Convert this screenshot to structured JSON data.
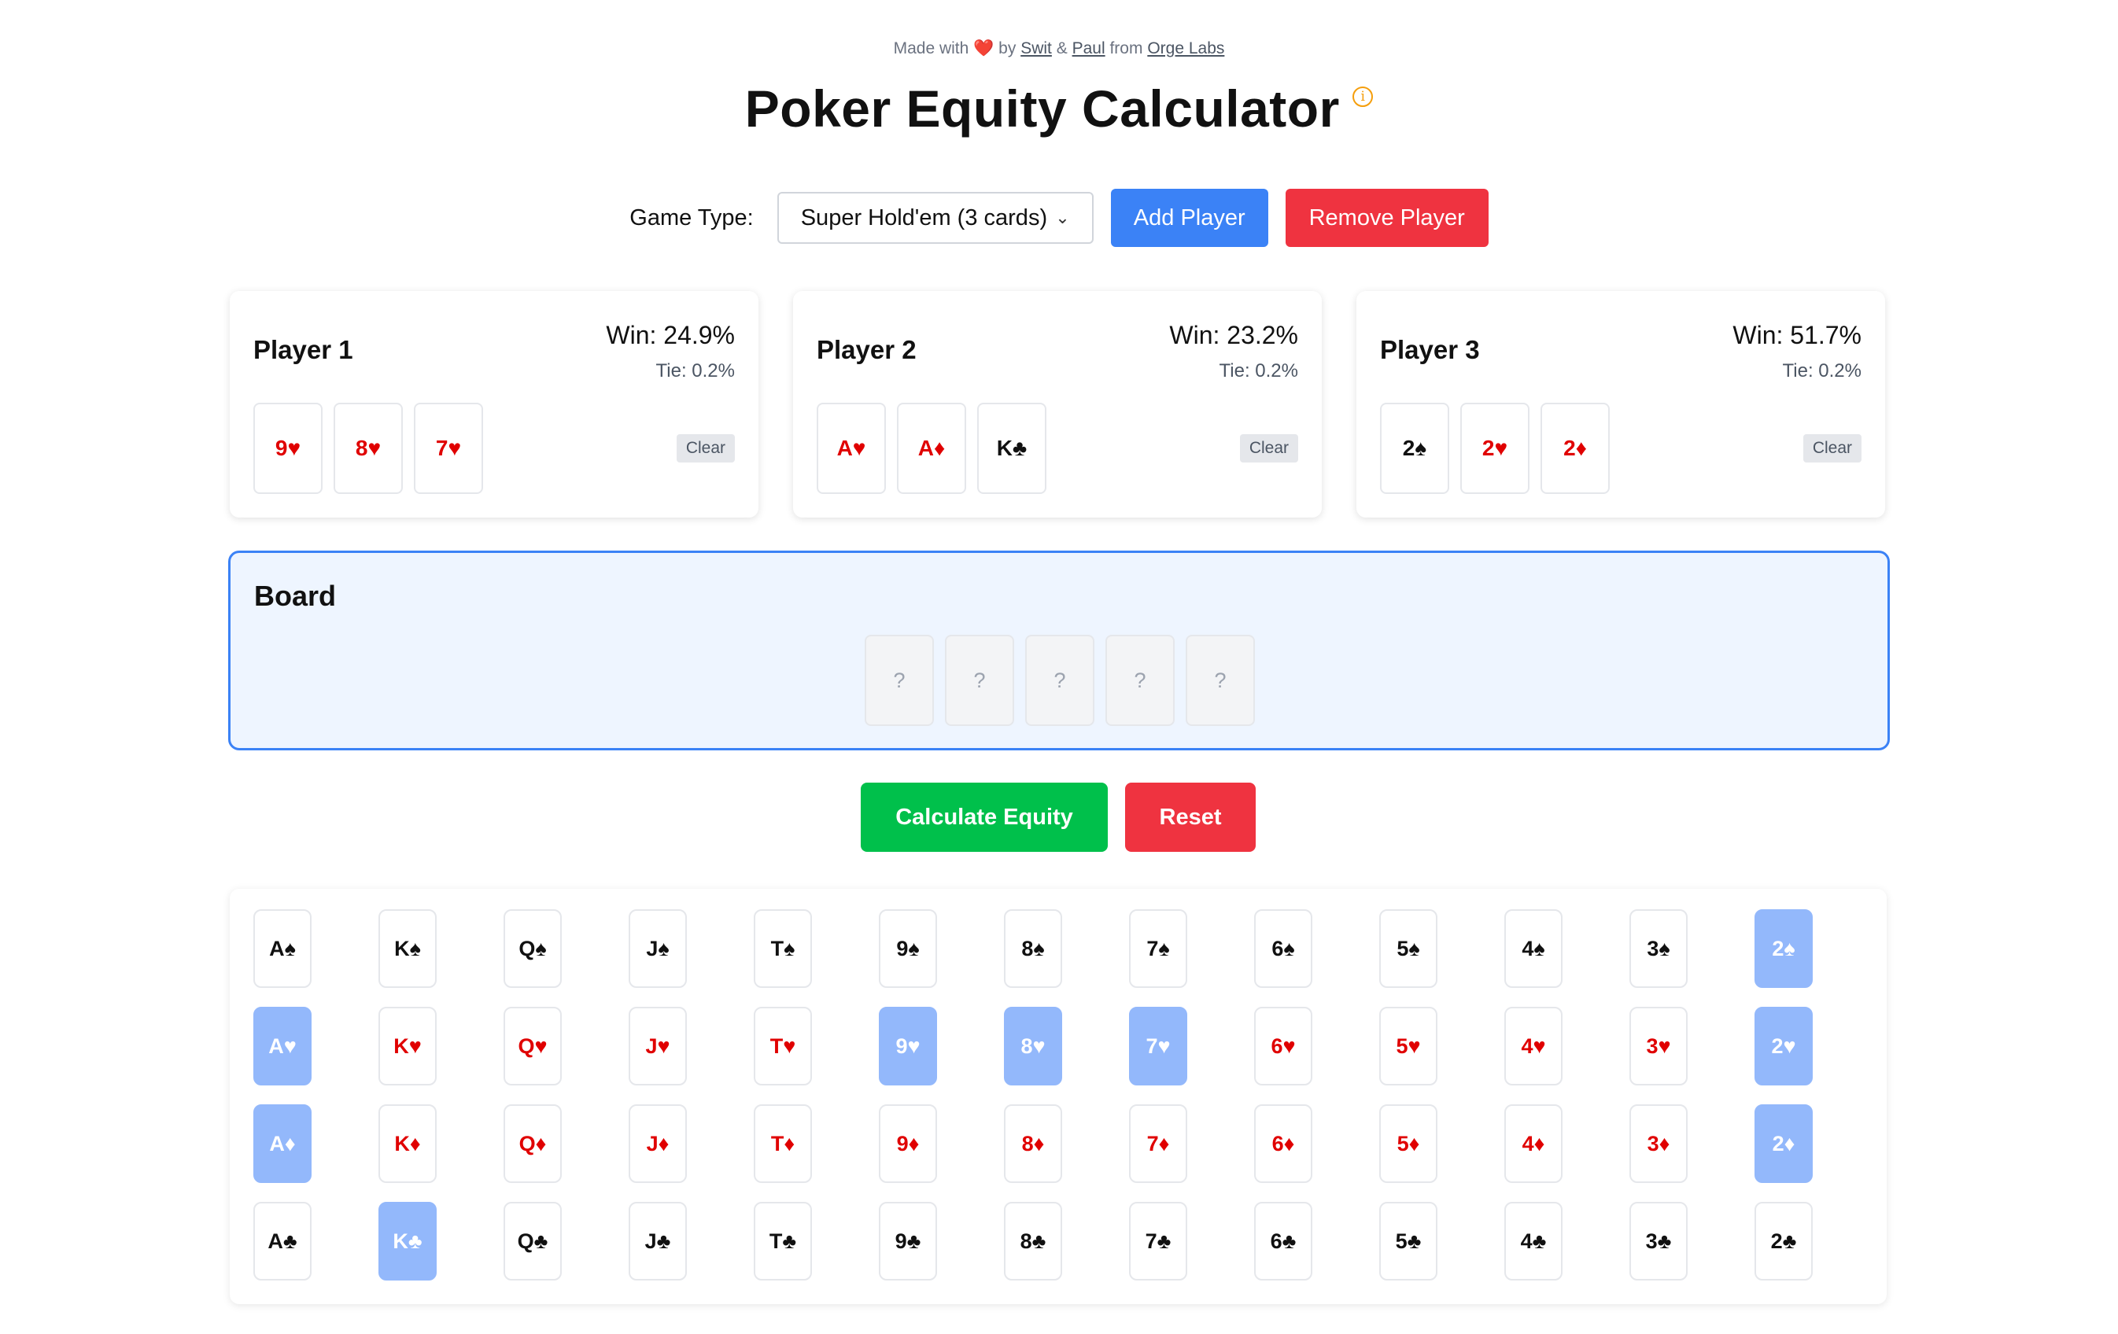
{
  "credit": {
    "prefix": "Made with",
    "heart": "❤️",
    "by": "by",
    "author1": "Swit",
    "amp": "&",
    "author2": "Paul",
    "from": "from",
    "org": "Orge Labs"
  },
  "title": "Poker Equity Calculator",
  "info_icon": "ⓘ",
  "controls": {
    "game_type_label": "Game Type:",
    "game_type_value": "Super Hold'em (3 cards)",
    "add_player": "Add Player",
    "remove_player": "Remove Player"
  },
  "players": [
    {
      "name": "Player 1",
      "win": "Win: 24.9%",
      "tie": "Tie: 0.2%",
      "cards": [
        {
          "label": "9♥",
          "color": "red"
        },
        {
          "label": "8♥",
          "color": "red"
        },
        {
          "label": "7♥",
          "color": "red"
        }
      ],
      "clear": "Clear"
    },
    {
      "name": "Player 2",
      "win": "Win: 23.2%",
      "tie": "Tie: 0.2%",
      "cards": [
        {
          "label": "A♥",
          "color": "red"
        },
        {
          "label": "A♦",
          "color": "red"
        },
        {
          "label": "K♣",
          "color": "black"
        }
      ],
      "clear": "Clear"
    },
    {
      "name": "Player 3",
      "win": "Win: 51.7%",
      "tie": "Tie: 0.2%",
      "cards": [
        {
          "label": "2♠",
          "color": "black"
        },
        {
          "label": "2♥",
          "color": "red"
        },
        {
          "label": "2♦",
          "color": "red"
        }
      ],
      "clear": "Clear"
    }
  ],
  "board": {
    "title": "Board",
    "slots": [
      "?",
      "?",
      "?",
      "?",
      "?"
    ]
  },
  "actions": {
    "calculate": "Calculate Equity",
    "reset": "Reset"
  },
  "deck": {
    "ranks": [
      "A",
      "K",
      "Q",
      "J",
      "T",
      "9",
      "8",
      "7",
      "6",
      "5",
      "4",
      "3",
      "2"
    ],
    "suits": [
      {
        "symbol": "♠",
        "name": "spades",
        "color": "black"
      },
      {
        "symbol": "♥",
        "name": "hearts",
        "color": "red"
      },
      {
        "symbol": "♦",
        "name": "diamonds",
        "color": "red"
      },
      {
        "symbol": "♣",
        "name": "clubs",
        "color": "black"
      }
    ],
    "selected": [
      "2♠",
      "A♥",
      "9♥",
      "8♥",
      "7♥",
      "2♥",
      "A♦",
      "2♦",
      "K♣"
    ]
  },
  "colors": {
    "accent_blue": "#3b82f6",
    "danger_red": "#ef3340",
    "success_green": "#00c04b",
    "selected_card": "#93b8fb",
    "suit_red": "#e00000"
  }
}
